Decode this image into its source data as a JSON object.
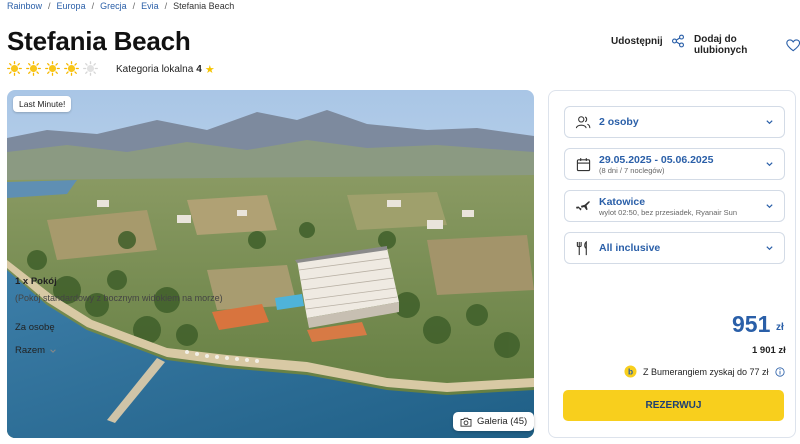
{
  "breadcrumb": [
    {
      "label": "Rainbow"
    },
    {
      "label": "Europa"
    },
    {
      "label": "Grecja"
    },
    {
      "label": "Evia"
    },
    {
      "label": "Stefania Beach"
    }
  ],
  "hotel": {
    "name": "Stefania Beach",
    "stars_filled": 4,
    "stars_total": 5,
    "category_label": "Kategoria lokalna",
    "category_value": "4"
  },
  "actions": {
    "share_label": "Udostępnij",
    "favorite_label": "Dodaj do ulubionych"
  },
  "hero": {
    "badge": "Last Minute!",
    "gallery_label": "Galeria (45)"
  },
  "booking": {
    "persons": "2 osoby",
    "dates": "29.05.2025 - 05.06.2025",
    "dates_sub": "(8 dni / 7 noclegów)",
    "departure_city": "Katowice",
    "departure_sub": "wylot 02:50, bez przesiadek, Ryanair Sun",
    "board": "All inclusive",
    "room_count": "1 x Pokój",
    "room_desc": "(Pokój standardowy z bocznym widokiem na morze)",
    "per_person_label": "Za osobę",
    "price": "951",
    "currency": "zł",
    "total_label": "Razem",
    "total_value": "1 901 zł",
    "boomerang_text": "Z Bumerangiem zyskaj do 77 zł",
    "reserve_label": "REZERWUJ"
  },
  "colors": {
    "accent_blue": "#2a5fa8",
    "reserve_yellow": "#f8cf1d",
    "star_gold": "#f5c400"
  }
}
